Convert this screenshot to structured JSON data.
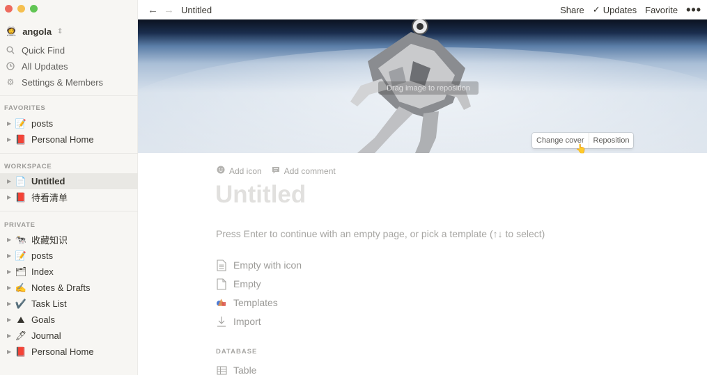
{
  "sidebar": {
    "workspace": {
      "name": "angola",
      "emoji": "👩‍🚀"
    },
    "nav": [
      {
        "label": "Quick Find",
        "icon": "search-icon"
      },
      {
        "label": "All Updates",
        "icon": "clock-icon"
      },
      {
        "label": "Settings & Members",
        "icon": "gear-icon"
      }
    ],
    "favorites_label": "FAVORITES",
    "favorites": [
      {
        "emoji": "📝",
        "label": "posts"
      },
      {
        "emoji": "📕",
        "label": "Personal Home"
      }
    ],
    "workspace_label": "WORKSPACE",
    "workspace_pages": [
      {
        "emoji": "📄",
        "label": "Untitled",
        "active": true
      },
      {
        "emoji": "📕",
        "label": "待看清单"
      }
    ],
    "private_label": "PRIVATE",
    "private_pages": [
      {
        "emoji": "🐄",
        "label": "收藏知识"
      },
      {
        "emoji": "📝",
        "label": "posts"
      },
      {
        "emoji": "🗂",
        "label": "Index"
      },
      {
        "emoji": "✍️",
        "label": "Notes & Drafts"
      },
      {
        "emoji": "✔️",
        "label": "Task List"
      },
      {
        "emoji": "⛰",
        "label": "Goals"
      },
      {
        "emoji": "🖊",
        "label": "Journal"
      },
      {
        "emoji": "📕",
        "label": "Personal Home"
      }
    ]
  },
  "topbar": {
    "back": "←",
    "forward": "→",
    "title": "Untitled",
    "share": "Share",
    "updates_check": "✓",
    "updates": "Updates",
    "favorite": "Favorite",
    "more": "•••"
  },
  "cover": {
    "drag_hint": "Drag image to reposition",
    "change_cover": "Change cover",
    "reposition": "Reposition"
  },
  "page": {
    "add_icon": "Add icon",
    "add_comment": "Add comment",
    "title_placeholder": "Untitled",
    "hint": "Press Enter to continue with an empty page, or pick a template (↑↓ to select)",
    "templates": [
      {
        "label": "Empty with icon",
        "icon": "page-icon"
      },
      {
        "label": "Empty",
        "icon": "page-icon"
      },
      {
        "label": "Templates",
        "icon": "templates-icon"
      },
      {
        "label": "Import",
        "icon": "import-icon"
      }
    ],
    "database_label": "DATABASE",
    "database_items": [
      {
        "label": "Table",
        "icon": "table-icon"
      }
    ]
  },
  "colors": {
    "sidebar_bg": "#f7f6f3",
    "active_item_bg": "#e9e8e4",
    "text": "#37352f",
    "muted": "#9b9a97"
  }
}
